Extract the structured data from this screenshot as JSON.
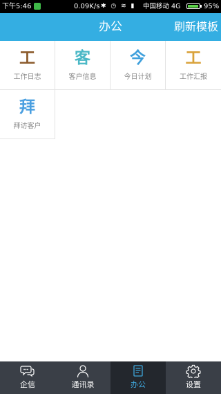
{
  "status_bar": {
    "time": "下午5:46",
    "speed": "0.09K/s",
    "icons": "✱ ◷ ≋ ▮",
    "carrier": "中国移动 4G",
    "battery_percent": "95%",
    "battery_level": 0.95
  },
  "header": {
    "title": "办公",
    "refresh_label": "刷新模板",
    "background": "#34aee2"
  },
  "modules": [
    {
      "glyph": "工",
      "label": "工作日志",
      "color": "#8b5a2b"
    },
    {
      "glyph": "客",
      "label": "客户信息",
      "color": "#4bb8c6"
    },
    {
      "glyph": "今",
      "label": "今日计划",
      "color": "#3fa0dc"
    },
    {
      "glyph": "工",
      "label": "工作汇报",
      "color": "#d9a23a"
    },
    {
      "glyph": "拜",
      "label": "拜访客户",
      "color": "#4a9fe0"
    }
  ],
  "bottom_nav": {
    "items": [
      {
        "label": "企信",
        "icon": "chat-bubble-icon"
      },
      {
        "label": "通讯录",
        "icon": "person-icon"
      },
      {
        "label": "办公",
        "icon": "document-icon",
        "active": true
      },
      {
        "label": "设置",
        "icon": "gear-icon"
      }
    ],
    "active_color": "#3fa7dc"
  }
}
